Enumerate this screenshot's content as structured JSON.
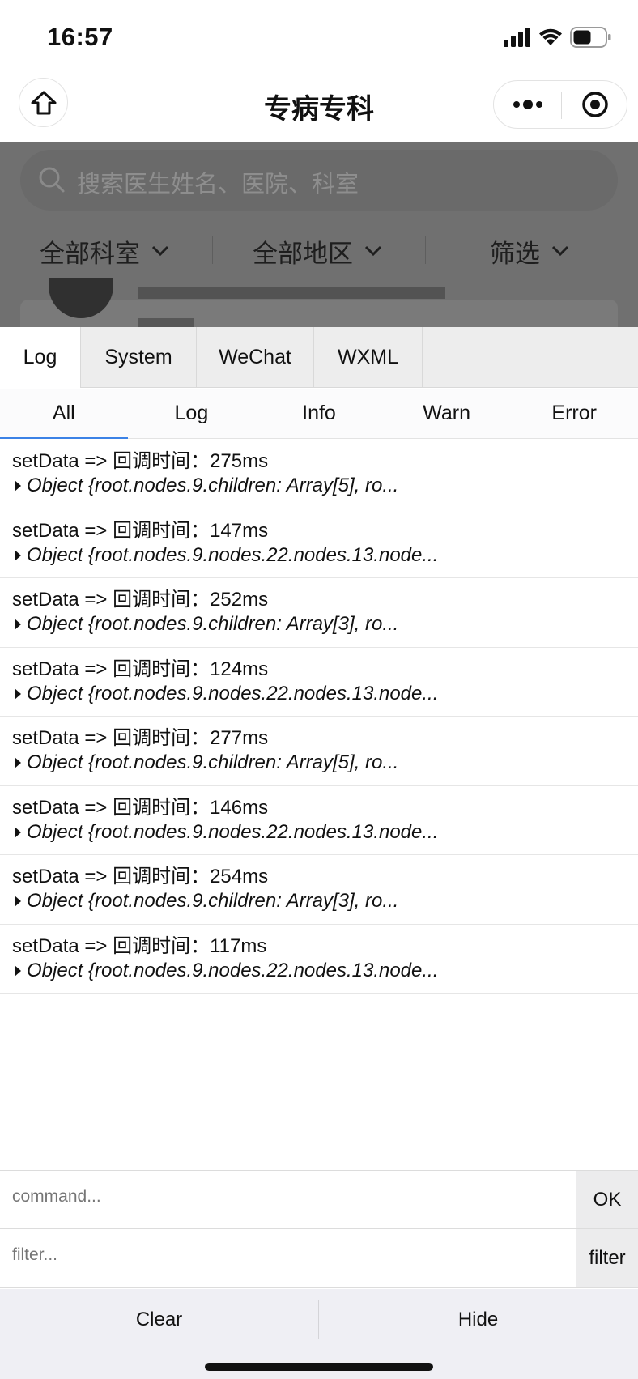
{
  "status_bar": {
    "time": "16:57"
  },
  "nav": {
    "title": "专病专科"
  },
  "background_page": {
    "search_placeholder": "搜索医生姓名、医院、科室",
    "filters": [
      "全部科室",
      "全部地区",
      "筛选"
    ]
  },
  "vconsole": {
    "tabs": [
      "Log",
      "System",
      "WeChat",
      "WXML"
    ],
    "active_tab": "Log",
    "subtabs": [
      "All",
      "Log",
      "Info",
      "Warn",
      "Error"
    ],
    "active_subtab": "All",
    "logs": [
      {
        "message": "setData => 回调时间：275ms",
        "object": "Object {root.nodes.9.children: Array[5], ro..."
      },
      {
        "message": "setData => 回调时间：147ms",
        "object": "Object {root.nodes.9.nodes.22.nodes.13.node..."
      },
      {
        "message": "setData => 回调时间：252ms",
        "object": "Object {root.nodes.9.children: Array[3], ro..."
      },
      {
        "message": "setData => 回调时间：124ms",
        "object": "Object {root.nodes.9.nodes.22.nodes.13.node..."
      },
      {
        "message": "setData => 回调时间：277ms",
        "object": "Object {root.nodes.9.children: Array[5], ro..."
      },
      {
        "message": "setData => 回调时间：146ms",
        "object": "Object {root.nodes.9.nodes.22.nodes.13.node..."
      },
      {
        "message": "setData => 回调时间：254ms",
        "object": "Object {root.nodes.9.children: Array[3], ro..."
      },
      {
        "message": "setData => 回调时间：117ms",
        "object": "Object {root.nodes.9.nodes.22.nodes.13.node..."
      }
    ],
    "command": {
      "placeholder": "command...",
      "button": "OK"
    },
    "filter": {
      "placeholder": "filter...",
      "button": "filter"
    },
    "toolbar": {
      "clear": "Clear",
      "hide": "Hide"
    }
  },
  "colors": {
    "accent": "#3b82e6",
    "overlay": "#707070",
    "toolbar_bg": "#efeff4"
  }
}
